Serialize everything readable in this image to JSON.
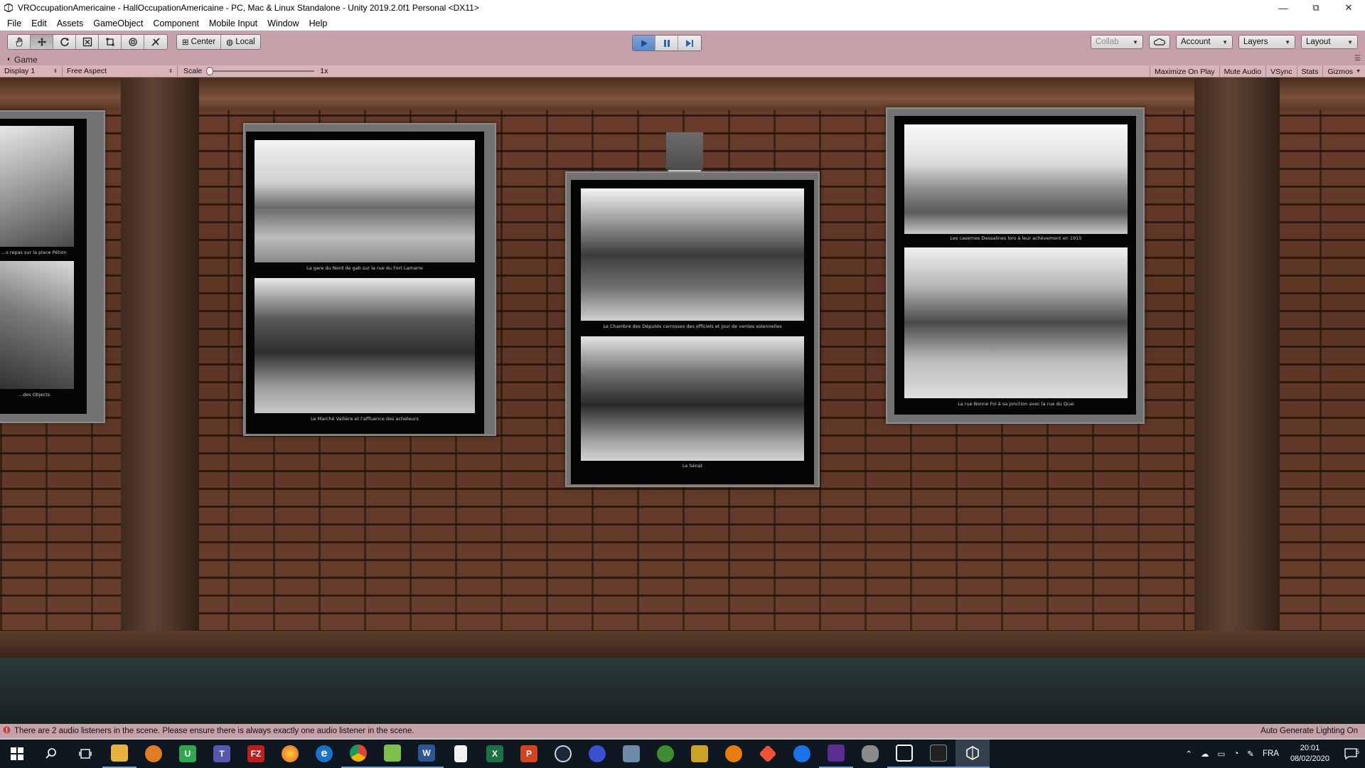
{
  "window": {
    "title": "VROccupationAmericaine - HallOccupationAmericaine - PC, Mac & Linux Standalone - Unity 2019.2.0f1 Personal <DX11>",
    "minimize": "—",
    "maximize": "⧉",
    "close": "✕"
  },
  "menu": [
    "File",
    "Edit",
    "Assets",
    "GameObject",
    "Component",
    "Mobile Input",
    "Window",
    "Help"
  ],
  "toolbar": {
    "tools": [
      "hand-tool-icon",
      "move-tool-icon",
      "rotate-tool-icon",
      "scale-tool-icon",
      "rect-tool-icon",
      "transform-tool-icon",
      "custom-tool-icon"
    ],
    "pivot_center": "Center",
    "pivot_local": "Local",
    "collab": "Collab",
    "account": "Account",
    "layers": "Layers",
    "layout": "Layout",
    "play_color": "#5b86c6"
  },
  "game_tab": {
    "label": "Game",
    "display": "Display 1",
    "aspect": "Free Aspect",
    "scale_label": "Scale",
    "scale_value": "1x",
    "options": [
      "Maximize On Play",
      "Mute Audio",
      "VSync",
      "Stats",
      "Gizmos"
    ]
  },
  "scene": {
    "captions": {
      "left_top": "...s repas sur la place Pétion",
      "left_bottom": "...des Objects",
      "p1_top": "La gare du Nord de gab sur la rue du Fort Lamarre",
      "p1_bottom": "Le Marché Vallière et l'affluence des acheteurs",
      "p2_top": "Le Chambre des Députés carrosses des officiels et jour de ventes solennelles",
      "p2_bottom": "Le Sénat",
      "p3_top": "Les casernes Dessalines lors à leur achèvement en 1915",
      "p3_bottom": "La rue Bonne Foi à sa jonction avec la rue du Quai"
    }
  },
  "status": {
    "message": "There are 2 audio listeners in the scene. Please ensure there is always exactly one audio listener in the scene.",
    "right": "Auto Generate Lighting On"
  },
  "taskbar": {
    "apps": [
      {
        "name": "start-icon",
        "color": "#0f1720",
        "label": ""
      },
      {
        "name": "search-icon",
        "color": "#0f1720",
        "label": ""
      },
      {
        "name": "task-view-icon",
        "color": "#0f1720",
        "label": ""
      },
      {
        "name": "file-explorer-icon",
        "color": "#e8b33c",
        "label": ""
      },
      {
        "name": "app-fox-icon",
        "color": "#e07b26",
        "label": ""
      },
      {
        "name": "app-u-icon",
        "color": "#2fa84f",
        "label": "U"
      },
      {
        "name": "teams-icon",
        "color": "#5558af",
        "label": "T"
      },
      {
        "name": "filezilla-icon",
        "color": "#bf1e1e",
        "label": "FZ"
      },
      {
        "name": "firefox-icon",
        "color": "#e8622b",
        "label": ""
      },
      {
        "name": "edge-icon",
        "color": "#1a73c9",
        "label": "e"
      },
      {
        "name": "chrome-icon",
        "color": "#e4b231",
        "label": ""
      },
      {
        "name": "notepad-plus-icon",
        "color": "#7fbf4b",
        "label": ""
      },
      {
        "name": "word-icon",
        "color": "#2b5797",
        "label": "W"
      },
      {
        "name": "file-icon",
        "color": "#f1f1f1",
        "label": ""
      },
      {
        "name": "excel-icon",
        "color": "#1e7145",
        "label": "X"
      },
      {
        "name": "powerpoint-icon",
        "color": "#d04423",
        "label": "P"
      },
      {
        "name": "steam-icon",
        "color": "#1b2838",
        "label": ""
      },
      {
        "name": "oculus-icon",
        "color": "#3b4fd1",
        "label": ""
      },
      {
        "name": "monitor-icon",
        "color": "#6d8aa8",
        "label": ""
      },
      {
        "name": "xbox-icon",
        "color": "#3e8e2f",
        "label": ""
      },
      {
        "name": "clapper-icon",
        "color": "#c9a227",
        "label": ""
      },
      {
        "name": "blender-icon",
        "color": "#e87d0d",
        "label": ""
      },
      {
        "name": "git-icon",
        "color": "#f05133",
        "label": ""
      },
      {
        "name": "maps-icon",
        "color": "#1a73e8",
        "label": ""
      },
      {
        "name": "visual-studio-icon",
        "color": "#5c2d91",
        "label": ""
      },
      {
        "name": "database-icon",
        "color": "#8a8a8a",
        "label": ""
      },
      {
        "name": "unity-hub-icon",
        "color": "#ffffff",
        "label": ""
      },
      {
        "name": "terminal-icon",
        "color": "#222222",
        "label": ""
      },
      {
        "name": "unity-icon",
        "color": "#ffffff",
        "label": ""
      }
    ],
    "lang": "FRA",
    "time": "20:01",
    "date": "08/02/2020",
    "notifications": "5"
  }
}
